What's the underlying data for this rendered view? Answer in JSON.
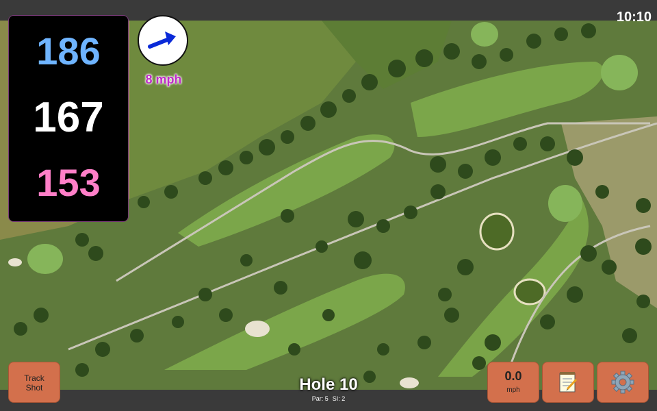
{
  "status": {
    "time": "10:10"
  },
  "distances": {
    "back": "186",
    "center": "167",
    "front": "153"
  },
  "wind": {
    "speed_label": "8 mph",
    "arrow_icon": "wind-arrow-icon"
  },
  "buttons": {
    "track_shot_line1": "Track",
    "track_shot_line2": "Shot",
    "speed_value": "0.0",
    "speed_unit": "mph",
    "notes_icon": "notepad-icon",
    "settings_icon": "gear-icon"
  },
  "hole": {
    "title": "Hole 10",
    "par": "Par: 5",
    "si": "SI: 2"
  },
  "colors": {
    "back": "#6fb4ff",
    "center": "#ffffff",
    "front": "#ff7fc8",
    "wind": "#c02cc8",
    "button": "#d3704c"
  }
}
